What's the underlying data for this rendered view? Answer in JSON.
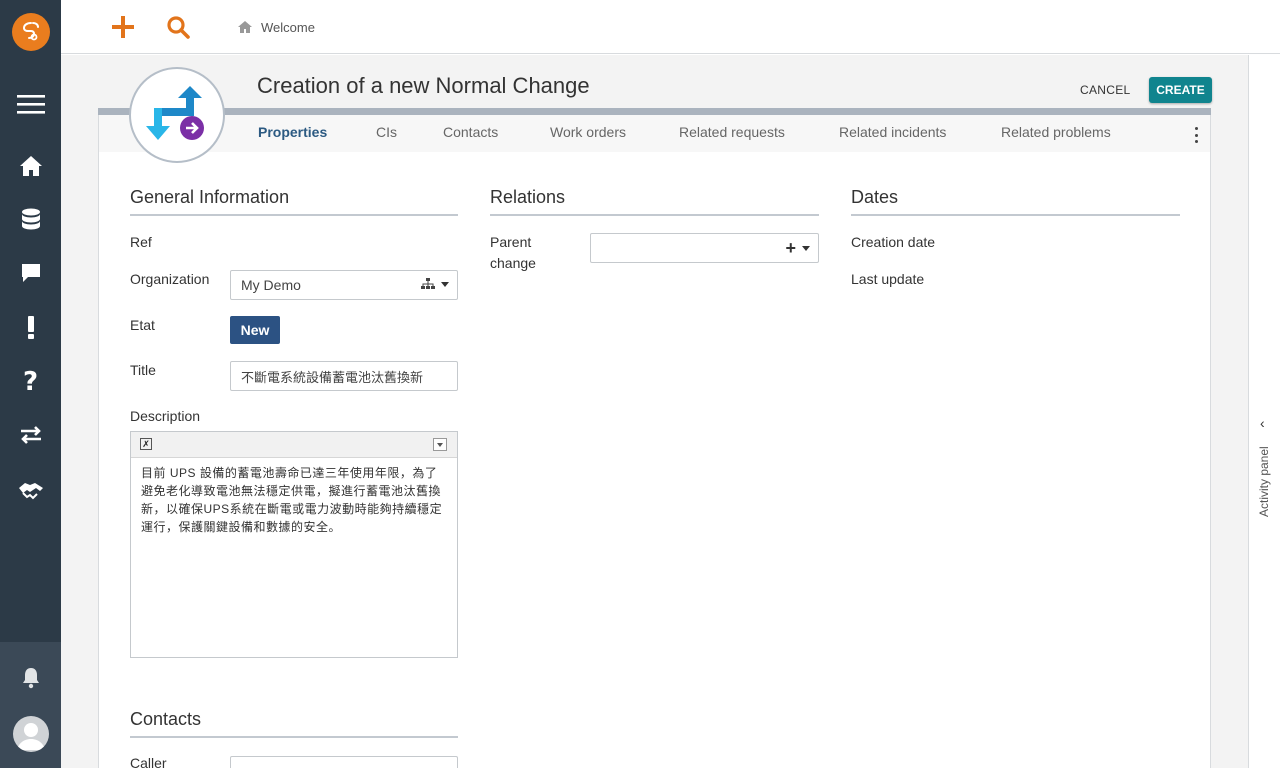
{
  "topbar": {
    "breadcrumb": "Welcome"
  },
  "header": {
    "title": "Creation of a new Normal Change",
    "cancel_label": "CANCEL",
    "create_label": "CREATE"
  },
  "tabs": [
    "Properties",
    "CIs",
    "Contacts",
    "Work orders",
    "Related requests",
    "Related incidents",
    "Related problems"
  ],
  "general": {
    "section_title": "General Information",
    "ref_label": "Ref",
    "organization_label": "Organization",
    "organization_value": "My Demo",
    "status_label": "Etat",
    "status_value": "New",
    "title_label": "Title",
    "title_value": "不斷電系統設備蓄電池汰舊換新",
    "description_label": "Description",
    "description_text": "目前 UPS 設備的蓄電池壽命已達三年使用年限，為了避免老化導致電池無法穩定供電，擬進行蓄電池汰舊換新，以確保UPS系統在斷電或電力波動時能夠持續穩定運行，保護關鍵設備和數據的安全。"
  },
  "relations": {
    "section_title": "Relations",
    "parent_change_label": "Parent change",
    "parent_change_value": ""
  },
  "dates": {
    "section_title": "Dates",
    "creation_date_label": "Creation date",
    "last_update_label": "Last update"
  },
  "contacts": {
    "section_title": "Contacts",
    "caller_label": "Caller"
  },
  "activity_panel": {
    "label": "Activity panel"
  },
  "colors": {
    "accent": "#10848e",
    "nav_bg": "#2c3a47",
    "brand": "#ea7d1e",
    "status_badge": "#2c5283"
  }
}
